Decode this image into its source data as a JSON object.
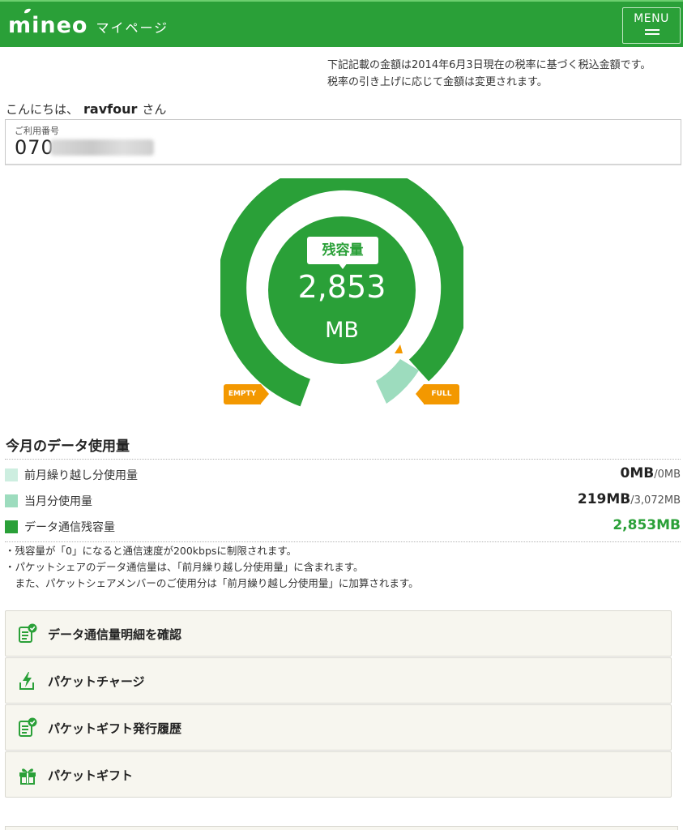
{
  "header": {
    "logo": "mineo",
    "subtitle": "マイページ",
    "menu_label": "MENU",
    "brand_color": "#2aa038"
  },
  "notice": {
    "line1": "下記記載の金額は2014年6月3日現在の税率に基づく税込金額です。",
    "line2": "税率の引き上げに応じて金額は変更されます。"
  },
  "greeting": {
    "prefix": "こんにちは、",
    "name": "ravfour",
    "suffix": "さん"
  },
  "account": {
    "label": "ご利用番号",
    "number_visible": "070"
  },
  "gauge": {
    "title": "残容量",
    "value": "2,853",
    "unit": "MB",
    "empty_label": "EMPTY",
    "full_label": "FULL",
    "remaining_fraction": 0.929
  },
  "usage": {
    "title": "今月のデータ使用量",
    "rows": [
      {
        "label": "前月繰り越し分使用量",
        "value": "0MB",
        "sub": "/0MB",
        "color": "#cdeee0"
      },
      {
        "label": "当月分使用量",
        "value": "219MB",
        "sub": "/3,072MB",
        "color": "#9ddcbe"
      },
      {
        "label": "データ通信残容量",
        "value": "2,853MB",
        "sub": "",
        "color": "#2aa038"
      }
    ],
    "notes": [
      "・残容量が「0」になると通信速度が200kbpsに制限されます。",
      "・パケットシェアのデータ通信量は、「前月繰り越し分使用量」に含まれます。",
      "　また、パケットシェアメンバーのご使用分は「前月繰り越し分使用量」に加算されます。"
    ]
  },
  "actions": [
    {
      "label": "データ通信量明細を確認",
      "icon": "document-check-icon"
    },
    {
      "label": "パケットチャージ",
      "icon": "lightning-charge-icon"
    },
    {
      "label": "パケットギフト発行履歴",
      "icon": "document-check-icon"
    },
    {
      "label": "パケットギフト",
      "icon": "gift-icon"
    }
  ]
}
